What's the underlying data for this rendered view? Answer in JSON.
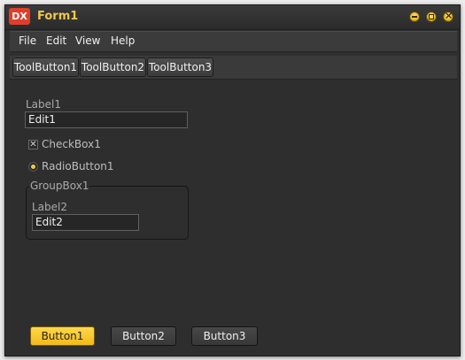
{
  "window": {
    "title": "Form1",
    "icon_text": "DX",
    "icon_color": "#e03e2d",
    "title_color": "#f0c64a",
    "controls": [
      "minimize-icon",
      "maximize-icon",
      "close-icon"
    ]
  },
  "menu": {
    "items": [
      {
        "label": "File"
      },
      {
        "label": "Edit"
      },
      {
        "label": "View"
      },
      {
        "label": "Help"
      }
    ]
  },
  "toolbar": {
    "buttons": [
      {
        "label": "ToolButton1"
      },
      {
        "label": "ToolButton2"
      },
      {
        "label": "ToolButton3"
      }
    ]
  },
  "form": {
    "label1": "Label1",
    "edit1_value": "Edit1",
    "checkbox1": {
      "label": "CheckBox1",
      "checked": true,
      "mark": "✕"
    },
    "radiobutton1": {
      "label": "RadioButton1",
      "selected": true
    },
    "groupbox1": {
      "caption": "GroupBox1",
      "label2": "Label2",
      "edit2_value": "Edit2"
    }
  },
  "buttons": [
    {
      "label": "Button1",
      "default": true
    },
    {
      "label": "Button2",
      "default": false
    },
    {
      "label": "Button3",
      "default": false
    }
  ],
  "colors": {
    "accent": "#f5c842",
    "background": "#2e2e2e"
  }
}
